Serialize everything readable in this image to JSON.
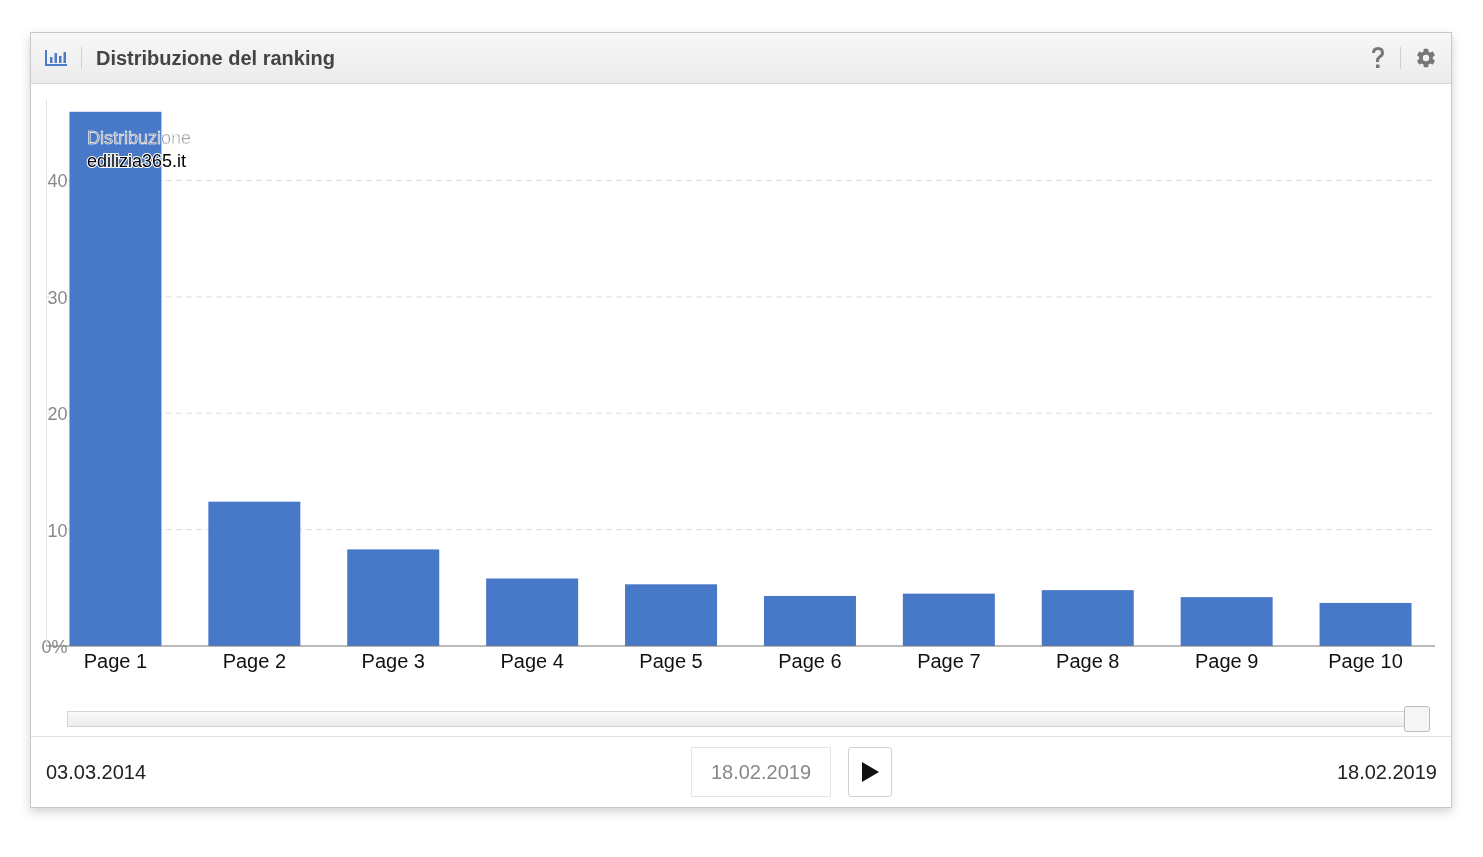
{
  "panel": {
    "title": "Distribuzione del ranking"
  },
  "chart": {
    "legend": {
      "title": "Distribuzione"
    },
    "chart_data": {
      "type": "bar",
      "categories": [
        "Page 1",
        "Page 2",
        "Page 3",
        "Page 4",
        "Page 5",
        "Page 6",
        "Page 7",
        "Page 8",
        "Page 9",
        "Page 10"
      ],
      "series": [
        {
          "name": "edilizia365.it",
          "color": "#4878c8",
          "values": [
            45.9,
            12.4,
            8.3,
            5.8,
            5.3,
            4.3,
            4.5,
            4.8,
            4.2,
            3.7
          ]
        }
      ],
      "ylim": [
        0,
        47
      ],
      "grid": true,
      "yticks": [
        {
          "value": 0,
          "label": "0%"
        },
        {
          "value": 10,
          "label": "10"
        },
        {
          "value": 20,
          "label": "20"
        },
        {
          "value": 30,
          "label": "30"
        },
        {
          "value": 40,
          "label": "40"
        }
      ]
    }
  },
  "timeline": {
    "level": 1,
    "start_date": "03.03.2014",
    "current_date": "18.02.2019",
    "end_date": "18.02.2019"
  }
}
